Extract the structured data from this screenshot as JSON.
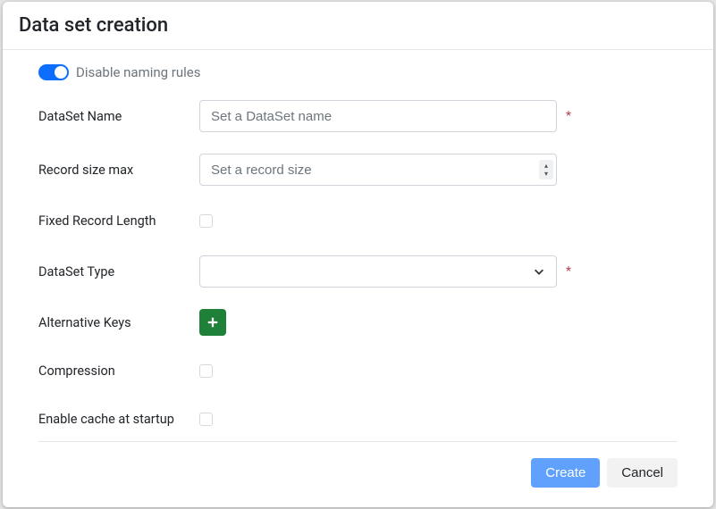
{
  "header": {
    "title": "Data set creation"
  },
  "toggle": {
    "label": "Disable naming rules",
    "checked": true
  },
  "fields": {
    "name": {
      "label": "DataSet Name",
      "placeholder": "Set a DataSet name",
      "value": "",
      "required": true
    },
    "recmax": {
      "label": "Record size max",
      "placeholder": "Set a record size",
      "value": "",
      "required": false
    },
    "fixed": {
      "label": "Fixed Record Length",
      "checked": false
    },
    "type": {
      "label": "DataSet Type",
      "selected": "",
      "required": true
    },
    "altkeys": {
      "label": "Alternative Keys"
    },
    "compress": {
      "label": "Compression",
      "checked": false
    },
    "cache": {
      "label": "Enable cache at startup",
      "checked": false
    }
  },
  "buttons": {
    "create": "Create",
    "cancel": "Cancel",
    "required_mark": "*"
  },
  "colors": {
    "accent": "#0d6efd",
    "success": "#1e8039",
    "primary_btn": "#60a1fd"
  }
}
